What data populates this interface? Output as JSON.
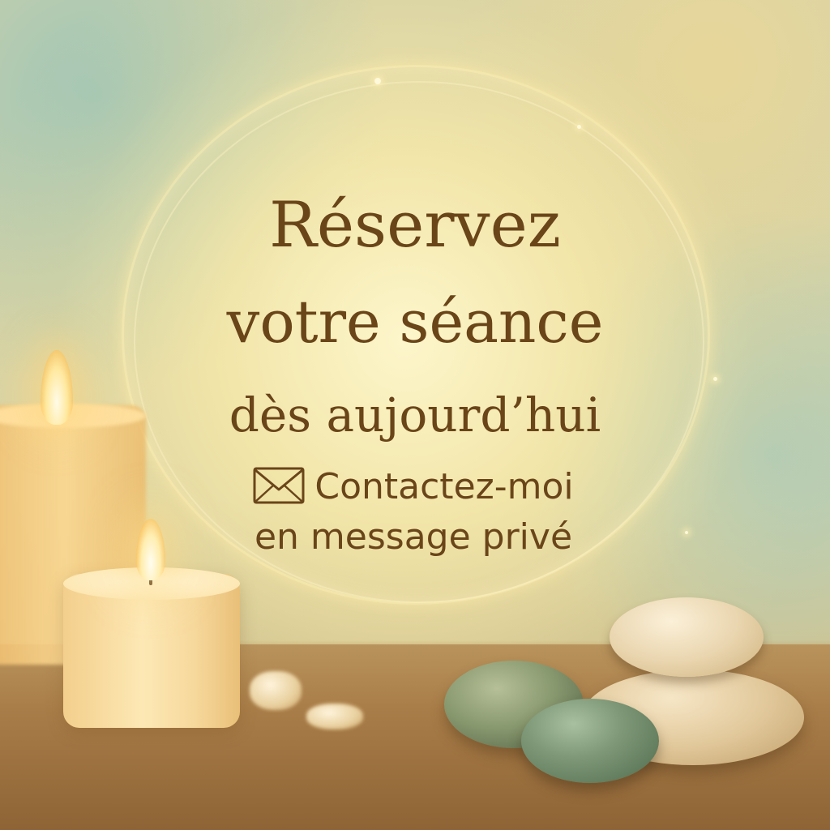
{
  "headline": {
    "line1": "Réservez",
    "line2": "votre séance",
    "line3": "dès aujourd’hui"
  },
  "contact": {
    "icon": "envelope-icon",
    "line1": "Contactez-moi",
    "line2": "en message privé"
  },
  "colors": {
    "text": "#6a4519",
    "glow": "#fff4c8",
    "teal": "#96c3b9",
    "wood": "#a97d48"
  }
}
